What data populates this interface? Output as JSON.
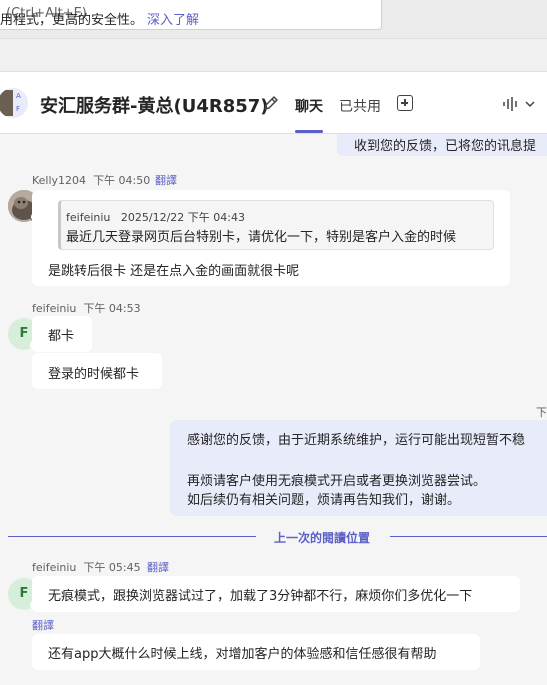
{
  "search": {
    "placeholder": "(Ctrl+Alt+E)"
  },
  "banner": {
    "text": "用程式，更高的安全性。",
    "link": "深入了解"
  },
  "header": {
    "title": "安汇服务群-黄总(U4R857)",
    "avatar_letters": [
      "A",
      "F"
    ],
    "tabs": [
      {
        "label": "聊天",
        "active": true
      },
      {
        "label": "已共用",
        "active": false
      }
    ]
  },
  "messages": {
    "top_clipped": "收到您的反馈，已将您的讯息提",
    "kelly": {
      "author": "Kelly1204",
      "time": "下午 04:50",
      "translate": "翻譯",
      "quote_author": "feifeiniu",
      "quote_time": "2025/12/22 下午 04:43",
      "quote_text": "最近几天登录网页后台特别卡，请优化一下，特别是客户入金的时候",
      "text": "是跳转后很卡  还是在点入金的画面就很卡呢"
    },
    "fei1": {
      "author": "feifeiniu",
      "time": "下午 04:53",
      "avatar_letter": "F",
      "line1": "都卡",
      "line2": "登录的时候都卡"
    },
    "me2": {
      "time_clipped": "下",
      "line1": "感谢您的反馈，由于近期系统维护，运行可能出现短暂不稳",
      "line2": "再烦请客户使用无痕模式开启或者更换浏览器尝试。",
      "line3": "如后续仍有相关问题，烦请再告知我们，谢谢。"
    },
    "divider": "上一次的閱讀位置",
    "fei2": {
      "author": "feifeiniu",
      "time": "下午 05:45",
      "translate": "翻譯",
      "avatar_letter": "F",
      "line1": "无痕模式，跟换浏览器试过了，加载了3分钟都不行，麻烦你们多优化一下",
      "translate2": "翻譯",
      "line2": "还有app大概什么时候上线，对增加客户的体验感和信任感很有帮助"
    }
  },
  "colors": {
    "accent": "#5b5fc7",
    "my_bubble": "#e8ebfa",
    "presence": "#13a10e"
  }
}
